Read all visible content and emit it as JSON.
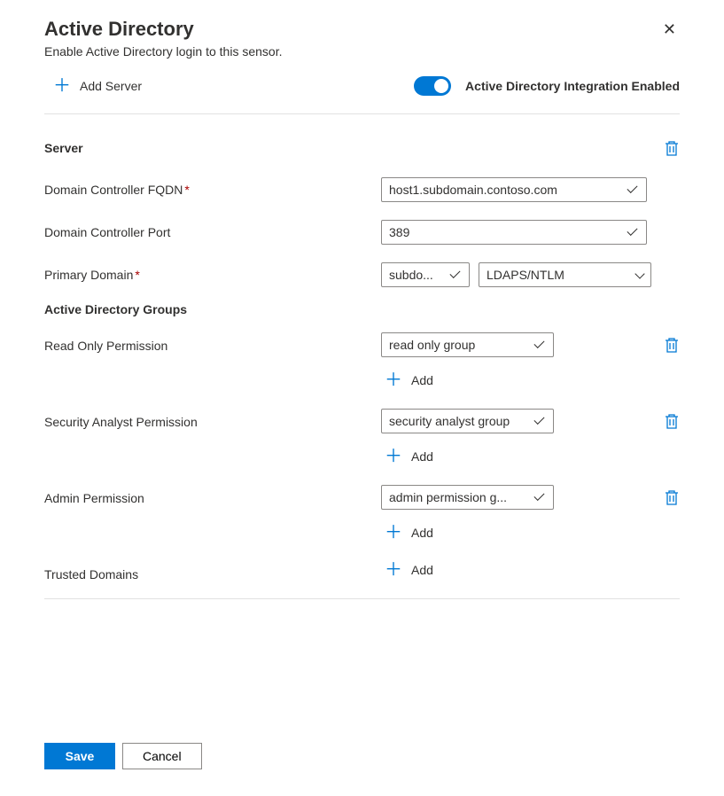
{
  "header": {
    "title": "Active Directory",
    "subtitle": "Enable Active Directory login to this sensor."
  },
  "top": {
    "add_server_label": "Add Server",
    "toggle_label": "Active Directory Integration Enabled",
    "toggle_on": true
  },
  "server": {
    "section_title": "Server",
    "fqdn_label": "Domain Controller FQDN",
    "fqdn_value": "host1.subdomain.contoso.com",
    "port_label": "Domain Controller Port",
    "port_value": "389",
    "primary_domain_label": "Primary Domain",
    "primary_domain_value": "subdo...",
    "auth_method_value": "LDAPS/NTLM"
  },
  "groups": {
    "heading": "Active Directory Groups",
    "read_only": {
      "label": "Read Only Permission",
      "value": "read only group",
      "add_label": "Add"
    },
    "security_analyst": {
      "label": "Security Analyst Permission",
      "value": "security analyst group",
      "add_label": "Add"
    },
    "admin": {
      "label": "Admin Permission",
      "value": "admin permission g...",
      "add_label": "Add"
    },
    "trusted_domains": {
      "label": "Trusted Domains",
      "add_label": "Add"
    }
  },
  "buttons": {
    "save": "Save",
    "cancel": "Cancel"
  }
}
